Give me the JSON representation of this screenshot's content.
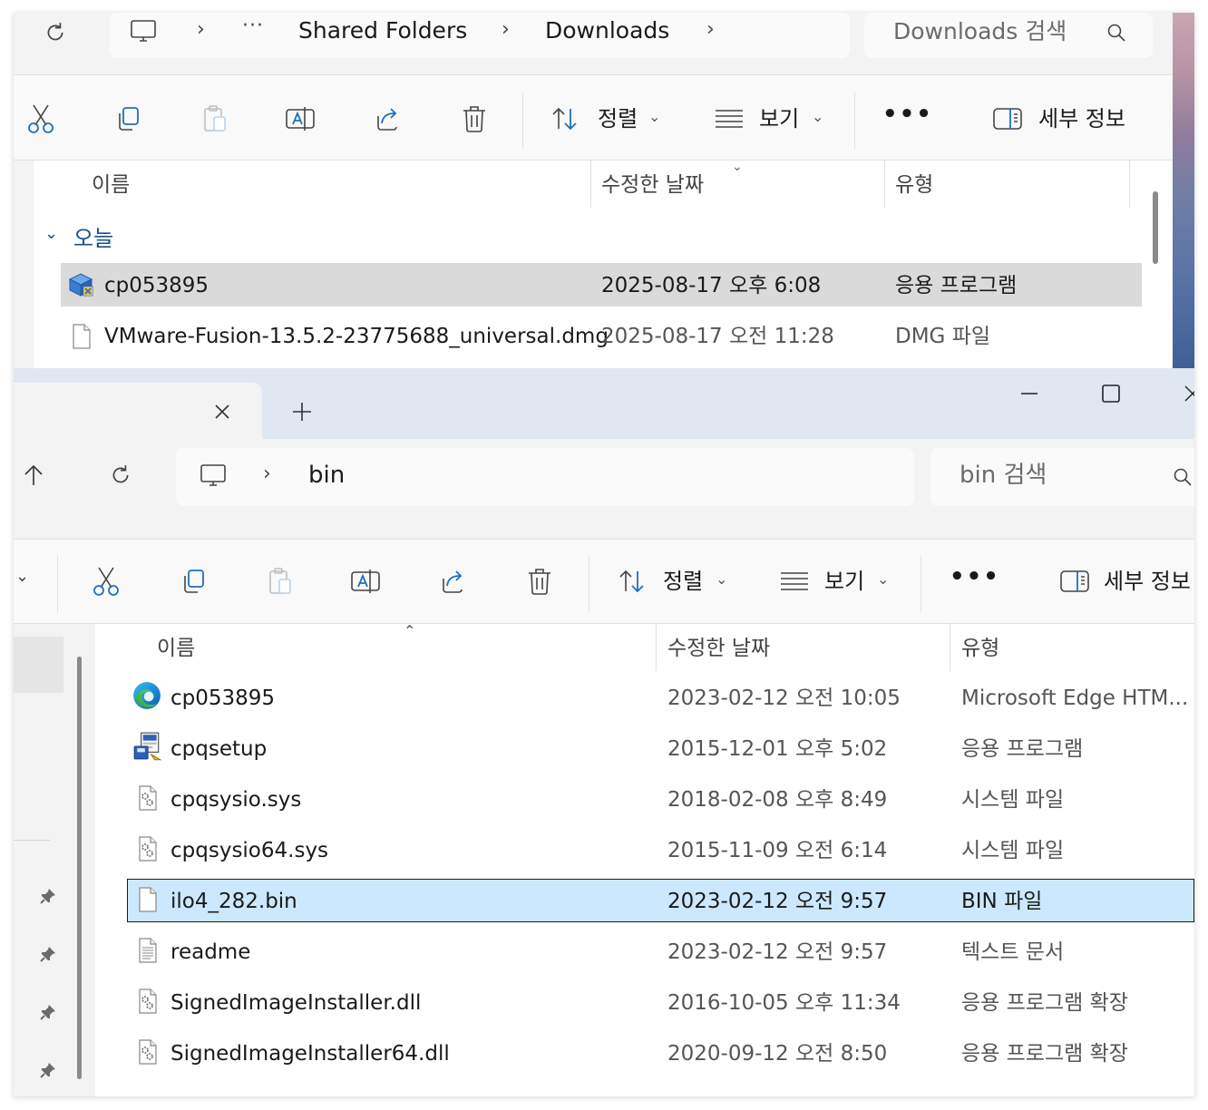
{
  "colors": {
    "accent": "#005fb8",
    "selected_row_bg": "#cce8ff",
    "selected_row_border": "#1a1a1a",
    "hover_row_bg": "#dadada"
  },
  "window_top": {
    "breadcrumb": [
      "Shared Folders",
      "Downloads"
    ],
    "search_placeholder": "Downloads 검색",
    "toolbar": {
      "sort_label": "정렬",
      "view_label": "보기",
      "details_label": "세부 정보"
    },
    "columns": {
      "name": "이름",
      "modified": "수정한 날짜",
      "type": "유형"
    },
    "group_label": "오늘",
    "rows": [
      {
        "name": "cp053895",
        "modified": "2025-08-17 오후 6:08",
        "type": "응용 프로그램",
        "icon": "installer-icon",
        "state": "hover"
      },
      {
        "name": "VMware-Fusion-13.5.2-23775688_universal.dmg",
        "modified": "2025-08-17 오전 11:28",
        "type": "DMG 파일",
        "icon": "blank-file-icon",
        "state": "normal"
      }
    ]
  },
  "window_bottom": {
    "breadcrumb": [
      "bin"
    ],
    "search_placeholder": "bin 검색",
    "toolbar": {
      "sort_label": "정렬",
      "view_label": "보기",
      "details_label": "세부 정보"
    },
    "columns": {
      "name": "이름",
      "modified": "수정한 날짜",
      "type": "유형"
    },
    "rows": [
      {
        "name": "cp053895",
        "modified": "2023-02-12 오전 10:05",
        "type": "Microsoft Edge HTM...",
        "icon": "edge-icon",
        "state": "normal"
      },
      {
        "name": "cpqsetup",
        "modified": "2015-12-01 오후 5:02",
        "type": "응용 프로그램",
        "icon": "setup-icon",
        "state": "normal"
      },
      {
        "name": "cpqsysio.sys",
        "modified": "2018-02-08 오후 8:49",
        "type": "시스템 파일",
        "icon": "system-file-icon",
        "state": "normal"
      },
      {
        "name": "cpqsysio64.sys",
        "modified": "2015-11-09 오전 6:14",
        "type": "시스템 파일",
        "icon": "system-file-icon",
        "state": "normal"
      },
      {
        "name": "ilo4_282.bin",
        "modified": "2023-02-12 오전 9:57",
        "type": "BIN 파일",
        "icon": "blank-file-icon",
        "state": "selected"
      },
      {
        "name": "readme",
        "modified": "2023-02-12 오전 9:57",
        "type": "텍스트 문서",
        "icon": "text-file-icon",
        "state": "normal"
      },
      {
        "name": "SignedImageInstaller.dll",
        "modified": "2016-10-05 오후 11:34",
        "type": "응용 프로그램 확장",
        "icon": "system-file-icon",
        "state": "normal"
      },
      {
        "name": "SignedImageInstaller64.dll",
        "modified": "2020-09-12 오전 8:50",
        "type": "응용 프로그램 확장",
        "icon": "system-file-icon",
        "state": "normal"
      }
    ]
  }
}
